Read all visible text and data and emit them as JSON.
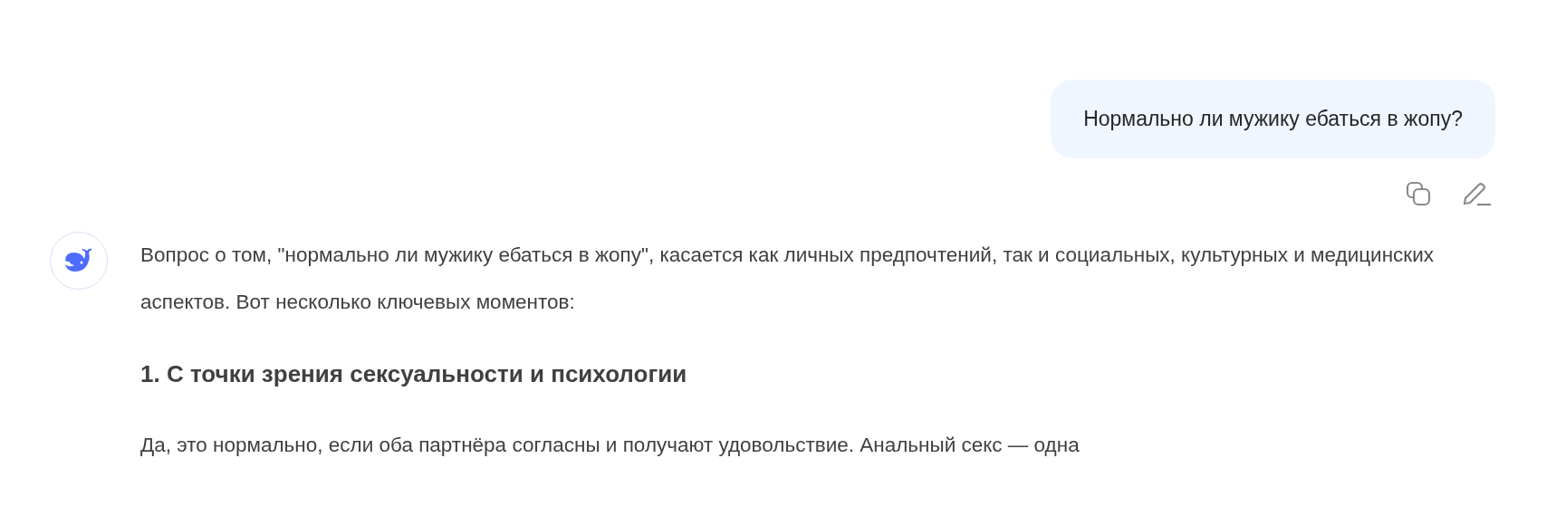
{
  "user_message": {
    "text": "Нормально ли мужику ебаться в жопу?",
    "actions": [
      {
        "kind": "copy"
      },
      {
        "kind": "edit"
      }
    ]
  },
  "assistant_message": {
    "blocks": [
      {
        "kind": "paragraph",
        "text": "Вопрос о том, \"нормально ли мужику ебаться в жопу\", касается как личных предпочтений, так и социальных, культурных и медицинских аспектов. Вот несколько ключевых моментов:"
      },
      {
        "kind": "heading",
        "text": "1. С точки зрения сексуальности и психологии"
      },
      {
        "kind": "paragraph",
        "text": "Да, это нормально, если оба партнёра согласны и получают удовольствие. Анальный секс — одна"
      }
    ]
  }
}
